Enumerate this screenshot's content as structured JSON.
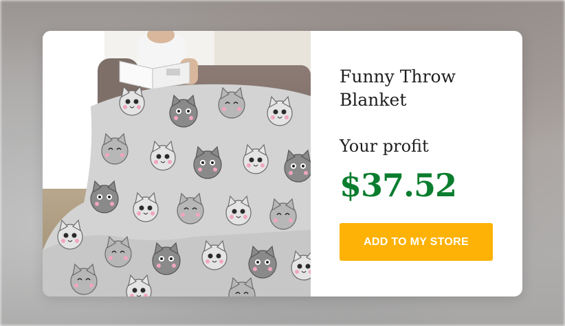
{
  "product": {
    "title": "Funny Throw Blanket",
    "image_subject": "woman-reading-under-grey-cat-pattern-blanket"
  },
  "profit": {
    "label": "Your profit",
    "value": "$37.52"
  },
  "actions": {
    "add_to_store_label": "ADD TO MY STORE"
  },
  "colors": {
    "card_background": "#ffffff",
    "profit_color": "#0a7d2e",
    "button_color": "#fdb205",
    "button_text_color": "#ffffff",
    "title_color": "#1e1e1e"
  }
}
